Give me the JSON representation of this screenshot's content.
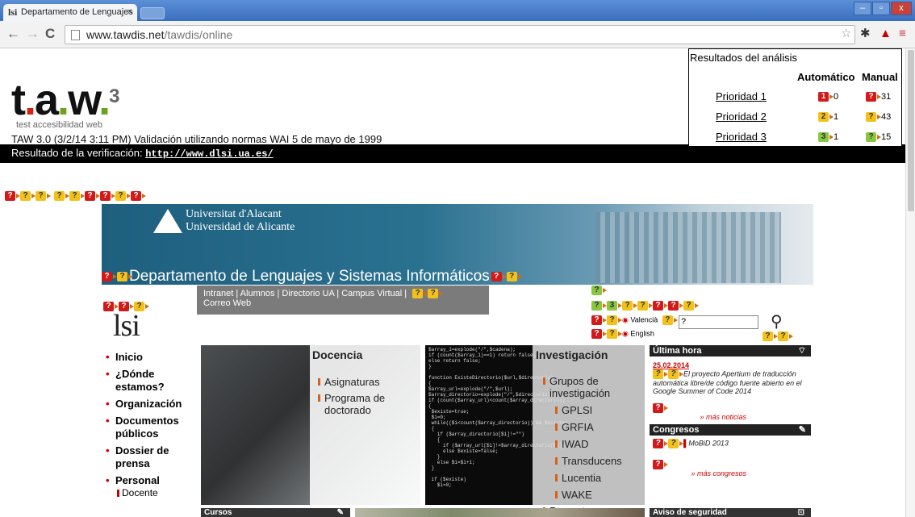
{
  "browser": {
    "tab_title": "Departamento de Lenguajes",
    "tab_favicon": "lsi",
    "tab_close": "×",
    "url_host": "www.tawdis.net",
    "url_path": "/tawdis/online",
    "window_min": "–",
    "window_max": "▫",
    "window_close": "x"
  },
  "taw": {
    "logo_letters": [
      "t",
      "a",
      "w"
    ],
    "logo_sup": "3",
    "subtitle": "test accesibilidad web",
    "validation": "TAW 3.0 (3/2/14 3:11 PM) Validación utilizando normas WAI 5 de mayo de 1999",
    "result_label": "Resultado de la verificación:",
    "result_url": "http://www.dlsi.ua.es/"
  },
  "analysis": {
    "title": "Resultados del análisis",
    "col_auto": "Automático",
    "col_manual": "Manual",
    "rows": [
      {
        "label": "Prioridad 1",
        "auto": "0",
        "manual": "31",
        "auto_icon": "1",
        "auto_color": "#d21a1a",
        "manual_color": "#d21a1a"
      },
      {
        "label": "Prioridad 2",
        "auto": "1",
        "manual": "43",
        "auto_icon": "2",
        "auto_color": "#f2c21a",
        "manual_color": "#f2c21a"
      },
      {
        "label": "Prioridad 3",
        "auto": "1",
        "manual": "15",
        "auto_icon": "3",
        "auto_color": "#8cc63f",
        "manual_color": "#8cc63f"
      }
    ]
  },
  "site": {
    "ua_line1": "Universitat d'Alacant",
    "ua_line2": "Universidad de Alicante",
    "dept": "Departamento de Lenguajes y Sistemas Informáticos",
    "topnav_line1": "Intranet  |  Alumnos  |  Directorio UA  |  Campus Virtual  |",
    "topnav_line2": "Correo Web",
    "lang_va": "Valencià",
    "lang_en": "English",
    "search_value": "?",
    "lsi_logo": "lsi",
    "leftnav": [
      "Inicio",
      "¿Dónde estamos?",
      "Organización",
      "Documentos públicos",
      "Dossier de prensa",
      "Personal"
    ],
    "leftnav_sub": "Docente",
    "docencia": {
      "title": "Docencia",
      "items": [
        "Asignaturas",
        "Programa de doctorado"
      ]
    },
    "investigacion": {
      "title": "Investigación",
      "items": [
        "Grupos de investigación",
        "GPLSI",
        "GRFIA",
        "IWAD",
        "Transducens",
        "Lucentia",
        "WAKE",
        "Proyectos"
      ]
    },
    "news": {
      "ultima_title": "Última hora",
      "ultima_date": "25.02.2014",
      "ultima_text": "El proyecto Apertium de traducción automática libre/de código fuente abierto en el Google Summer of Code 2014",
      "ultima_more": "» más noticias",
      "congresos_title": "Congresos",
      "congresos_item": "MoBiD 2013",
      "congresos_more": "» más congresos",
      "aviso_title": "Aviso de seguridad"
    },
    "cursos_title": "Cursos",
    "code_snippet": "$array_1=explode(\"/\",$cadena);\nif (count($array_1)==1) return false;\nelse return false;\n}\n\nfunction ExisteDirectorio($url,$directorio)\n{\n$array_url=explode(\"/\",$url);\n$array_directorio=explode(\"/\",$directorio);\nif (count($array_url)<count($array_directorio))\n{\n $existe=true;\n $i=0;\n while(($i<count($array_directorio)) && $existe)\n {\n   if ($array_directorio[$i]!=\"\")\n   {\n     if ($array_url[$i]!=$array_directorio[$i])\n     else $existe=false;\n   }\n   else $i=$i+1;\n }\n\n if ($existe)\n   $i=0;"
  }
}
